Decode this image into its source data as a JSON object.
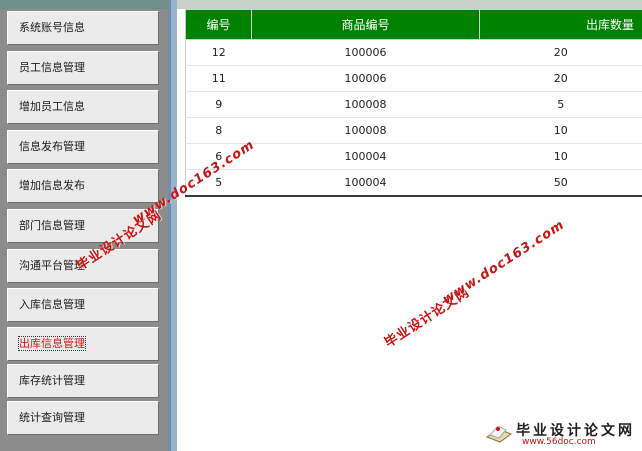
{
  "sidebar": {
    "items": [
      {
        "label": "系统账号信息"
      },
      {
        "label": "员工信息管理"
      },
      {
        "label": "增加员工信息"
      },
      {
        "label": "信息发布管理"
      },
      {
        "label": "增加信息发布"
      },
      {
        "label": "部门信息管理"
      },
      {
        "label": "沟通平台管理"
      },
      {
        "label": "入库信息管理"
      },
      {
        "label": "出库信息管理"
      },
      {
        "label": "库存统计管理"
      },
      {
        "label": "统计查询管理"
      }
    ],
    "active_index": 8
  },
  "table": {
    "headers": [
      "编号",
      "商品编号",
      "出库数量"
    ],
    "rows": [
      [
        "12",
        "100006",
        "20"
      ],
      [
        "11",
        "100006",
        "20"
      ],
      [
        "9",
        "100008",
        "5"
      ],
      [
        "8",
        "100008",
        "10"
      ],
      [
        "6",
        "100004",
        "10"
      ],
      [
        "5",
        "100004",
        "50"
      ]
    ],
    "header_color": "#008200"
  },
  "watermarks": [
    {
      "text": "毕业设计论文网"
    },
    {
      "text": "www.doc163.com"
    },
    {
      "text": "毕业设计论文网"
    },
    {
      "text": "www.doc163.com"
    }
  ],
  "logo": {
    "title": "毕业设计论文网",
    "url": "www.56doc.com"
  },
  "colors": {
    "accent": "#008200",
    "active_text": "#d01818",
    "watermark": "#c81414"
  }
}
